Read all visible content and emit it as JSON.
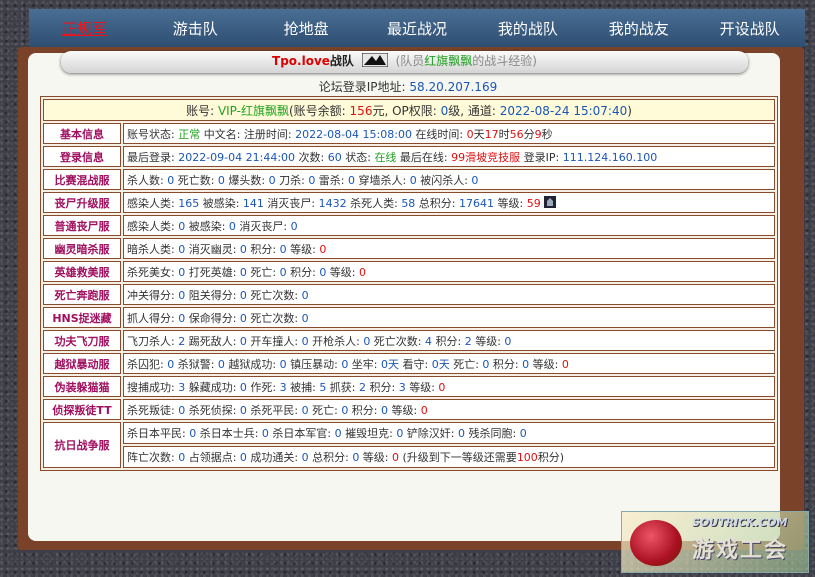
{
  "nav": {
    "items": [
      "正规军",
      "游击队",
      "抢地盘",
      "最近战况",
      "我的战队",
      "我的战友",
      "开设战队"
    ],
    "active_index": 0
  },
  "title": {
    "team": "Tpo.love",
    "team_suffix": "战队",
    "flag_icon": "team-flag-icon",
    "prefix": "(队员",
    "member": "红旗飘飘",
    "suffix": "的战斗经验)"
  },
  "ip": {
    "label": "论坛登录IP地址:",
    "value": "58.20.207.169"
  },
  "account": {
    "p1": "账号: ",
    "id": "VIP-红旗飘飘",
    "p2": "(账号余额: ",
    "balance": "156",
    "p3": "元, OP权限: ",
    "op": "0",
    "p4": "级, 通道: ",
    "time": "2022-08-24 15:07:40",
    "p5": ")"
  },
  "rows": [
    {
      "label": "基本信息",
      "segs": [
        [
          "账号状态: ",
          ""
        ],
        [
          "正常",
          "green"
        ],
        [
          " 中文名:   注册时间: ",
          ""
        ],
        [
          "2022-08-04 15:08:00",
          "blue"
        ],
        [
          " 在线时间: ",
          ""
        ],
        [
          "0",
          "red"
        ],
        [
          "天",
          ""
        ],
        [
          "17",
          "red"
        ],
        [
          "时",
          ""
        ],
        [
          "56",
          "red"
        ],
        [
          "分",
          ""
        ],
        [
          "9",
          "red"
        ],
        [
          "秒",
          ""
        ]
      ]
    },
    {
      "label": "登录信息",
      "segs": [
        [
          "最后登录: ",
          ""
        ],
        [
          "2022-09-04 21:44:00",
          "blue"
        ],
        [
          " 次数: ",
          ""
        ],
        [
          "60",
          "blue"
        ],
        [
          " 状态: ",
          ""
        ],
        [
          "在线",
          "green"
        ],
        [
          " 最后在线: ",
          ""
        ],
        [
          "99滑坡竞技服",
          "red"
        ],
        [
          " 登录IP: ",
          ""
        ],
        [
          "111.124.160.100",
          "blue"
        ]
      ]
    },
    {
      "label": "比赛混战服",
      "segs": [
        [
          "杀人数: ",
          ""
        ],
        [
          "0",
          "blue"
        ],
        [
          " 死亡数: ",
          ""
        ],
        [
          "0",
          "blue"
        ],
        [
          " 爆头数: ",
          ""
        ],
        [
          "0",
          "blue"
        ],
        [
          " 刀杀: ",
          ""
        ],
        [
          "0",
          "blue"
        ],
        [
          " 雷杀: ",
          ""
        ],
        [
          "0",
          "blue"
        ],
        [
          " 穿墙杀人: ",
          ""
        ],
        [
          "0",
          "blue"
        ],
        [
          " 被闪杀人: ",
          ""
        ],
        [
          "0",
          "blue"
        ]
      ]
    },
    {
      "label": "丧尸升级服",
      "segs": [
        [
          "感染人类: ",
          ""
        ],
        [
          "165",
          "blue"
        ],
        [
          " 被感染: ",
          ""
        ],
        [
          "141",
          "blue"
        ],
        [
          " 消灭丧尸: ",
          ""
        ],
        [
          "1432",
          "blue"
        ],
        [
          " 杀死人类: ",
          ""
        ],
        [
          "58",
          "blue"
        ],
        [
          " 总积分: ",
          ""
        ],
        [
          "17641",
          "blue"
        ],
        [
          " 等级: ",
          ""
        ],
        [
          "59",
          "red"
        ]
      ],
      "icon": "rank-badge-icon"
    },
    {
      "label": "普通丧尸服",
      "segs": [
        [
          "感染人类: ",
          ""
        ],
        [
          "0",
          "blue"
        ],
        [
          " 被感染: ",
          ""
        ],
        [
          "0",
          "blue"
        ],
        [
          " 消灭丧尸: ",
          ""
        ],
        [
          "0",
          "blue"
        ]
      ]
    },
    {
      "label": "幽灵暗杀服",
      "segs": [
        [
          "暗杀人类: ",
          ""
        ],
        [
          "0",
          "blue"
        ],
        [
          " 消灭幽灵: ",
          ""
        ],
        [
          "0",
          "blue"
        ],
        [
          " 积分: ",
          ""
        ],
        [
          "0",
          "blue"
        ],
        [
          " 等级: ",
          ""
        ],
        [
          "0",
          "red"
        ]
      ]
    },
    {
      "label": "英雄救美服",
      "segs": [
        [
          "杀死美女: ",
          ""
        ],
        [
          "0",
          "blue"
        ],
        [
          " 打死英雄: ",
          ""
        ],
        [
          "0",
          "blue"
        ],
        [
          " 死亡: ",
          ""
        ],
        [
          "0",
          "blue"
        ],
        [
          " 积分: ",
          ""
        ],
        [
          "0",
          "blue"
        ],
        [
          " 等级: ",
          ""
        ],
        [
          "0",
          "red"
        ]
      ]
    },
    {
      "label": "死亡奔跑服",
      "segs": [
        [
          "冲关得分: ",
          ""
        ],
        [
          "0",
          "blue"
        ],
        [
          " 阻关得分: ",
          ""
        ],
        [
          "0",
          "blue"
        ],
        [
          " 死亡次数: ",
          ""
        ],
        [
          "0",
          "blue"
        ]
      ]
    },
    {
      "label": "HNS捉迷藏",
      "segs": [
        [
          "抓人得分: ",
          ""
        ],
        [
          "0",
          "blue"
        ],
        [
          " 保命得分: ",
          ""
        ],
        [
          "0",
          "blue"
        ],
        [
          " 死亡次数: ",
          ""
        ],
        [
          "0",
          "blue"
        ]
      ]
    },
    {
      "label": "功夫飞刀服",
      "segs": [
        [
          "飞刀杀人: ",
          ""
        ],
        [
          "2",
          "blue"
        ],
        [
          " 踢死敌人: ",
          ""
        ],
        [
          "0",
          "blue"
        ],
        [
          " 开车撞人: ",
          ""
        ],
        [
          "0",
          "blue"
        ],
        [
          " 开枪杀人: ",
          ""
        ],
        [
          "0",
          "blue"
        ],
        [
          " 死亡次数: ",
          ""
        ],
        [
          "4",
          "blue"
        ],
        [
          " 积分: ",
          ""
        ],
        [
          "2",
          "blue"
        ],
        [
          " 等级: ",
          ""
        ],
        [
          "0",
          "blue"
        ]
      ]
    },
    {
      "label": "越狱暴动服",
      "segs": [
        [
          "杀囚犯: ",
          ""
        ],
        [
          "0",
          "blue"
        ],
        [
          " 杀狱警: ",
          ""
        ],
        [
          "0",
          "blue"
        ],
        [
          " 越狱成功: ",
          ""
        ],
        [
          "0",
          "blue"
        ],
        [
          " 镇压暴动: ",
          ""
        ],
        [
          "0",
          "blue"
        ],
        [
          " 坐牢: ",
          ""
        ],
        [
          "0天",
          "blue"
        ],
        [
          " 看守: ",
          ""
        ],
        [
          "0天",
          "blue"
        ],
        [
          " 死亡: ",
          ""
        ],
        [
          "0",
          "blue"
        ],
        [
          " 积分: ",
          ""
        ],
        [
          "0",
          "blue"
        ],
        [
          " 等级: ",
          ""
        ],
        [
          "0",
          "red"
        ]
      ]
    },
    {
      "label": "伪装躲猫猫",
      "segs": [
        [
          "搜捕成功: ",
          ""
        ],
        [
          "3",
          "blue"
        ],
        [
          " 躲藏成功: ",
          ""
        ],
        [
          "0",
          "blue"
        ],
        [
          " 作死: ",
          ""
        ],
        [
          "3",
          "blue"
        ],
        [
          " 被捕: ",
          ""
        ],
        [
          "5",
          "blue"
        ],
        [
          " 抓获: ",
          ""
        ],
        [
          "2",
          "blue"
        ],
        [
          " 积分: ",
          ""
        ],
        [
          "3",
          "blue"
        ],
        [
          " 等级: ",
          ""
        ],
        [
          "0",
          "red"
        ]
      ]
    },
    {
      "label": "侦探叛徒TT",
      "segs": [
        [
          "杀死叛徒: ",
          ""
        ],
        [
          "0",
          "blue"
        ],
        [
          " 杀死侦探: ",
          ""
        ],
        [
          "0",
          "blue"
        ],
        [
          " 杀死平民: ",
          ""
        ],
        [
          "0",
          "blue"
        ],
        [
          " 死亡: ",
          ""
        ],
        [
          "0",
          "blue"
        ],
        [
          " 积分: ",
          ""
        ],
        [
          "0",
          "blue"
        ],
        [
          " 等级: ",
          ""
        ],
        [
          "0",
          "red"
        ]
      ]
    }
  ],
  "war": {
    "label": "抗日战争服",
    "line1": [
      [
        "杀日本平民: ",
        ""
      ],
      [
        "0",
        "blue"
      ],
      [
        " 杀日本士兵: ",
        ""
      ],
      [
        "0",
        "blue"
      ],
      [
        " 杀日本军官: ",
        ""
      ],
      [
        "0",
        "blue"
      ],
      [
        " 摧毁坦克: ",
        ""
      ],
      [
        "0",
        "blue"
      ],
      [
        " 铲除汉奸: ",
        ""
      ],
      [
        "0",
        "blue"
      ],
      [
        " 残杀同胞: ",
        ""
      ],
      [
        "0",
        "blue"
      ]
    ],
    "line2": [
      [
        "阵亡次数: ",
        ""
      ],
      [
        "0",
        "blue"
      ],
      [
        " 占领据点: ",
        ""
      ],
      [
        "0",
        "blue"
      ],
      [
        " 成功通关: ",
        ""
      ],
      [
        "0",
        "blue"
      ],
      [
        " 总积分: ",
        ""
      ],
      [
        "0",
        "blue"
      ],
      [
        " 等级: ",
        ""
      ],
      [
        "0",
        "red"
      ],
      [
        " (升级到下一等级还需要",
        ""
      ],
      [
        "100",
        "red"
      ],
      [
        "积分)",
        ""
      ]
    ]
  },
  "watermark": {
    "top": "SOUTRICK.COM",
    "bottom": "游戏工会"
  }
}
